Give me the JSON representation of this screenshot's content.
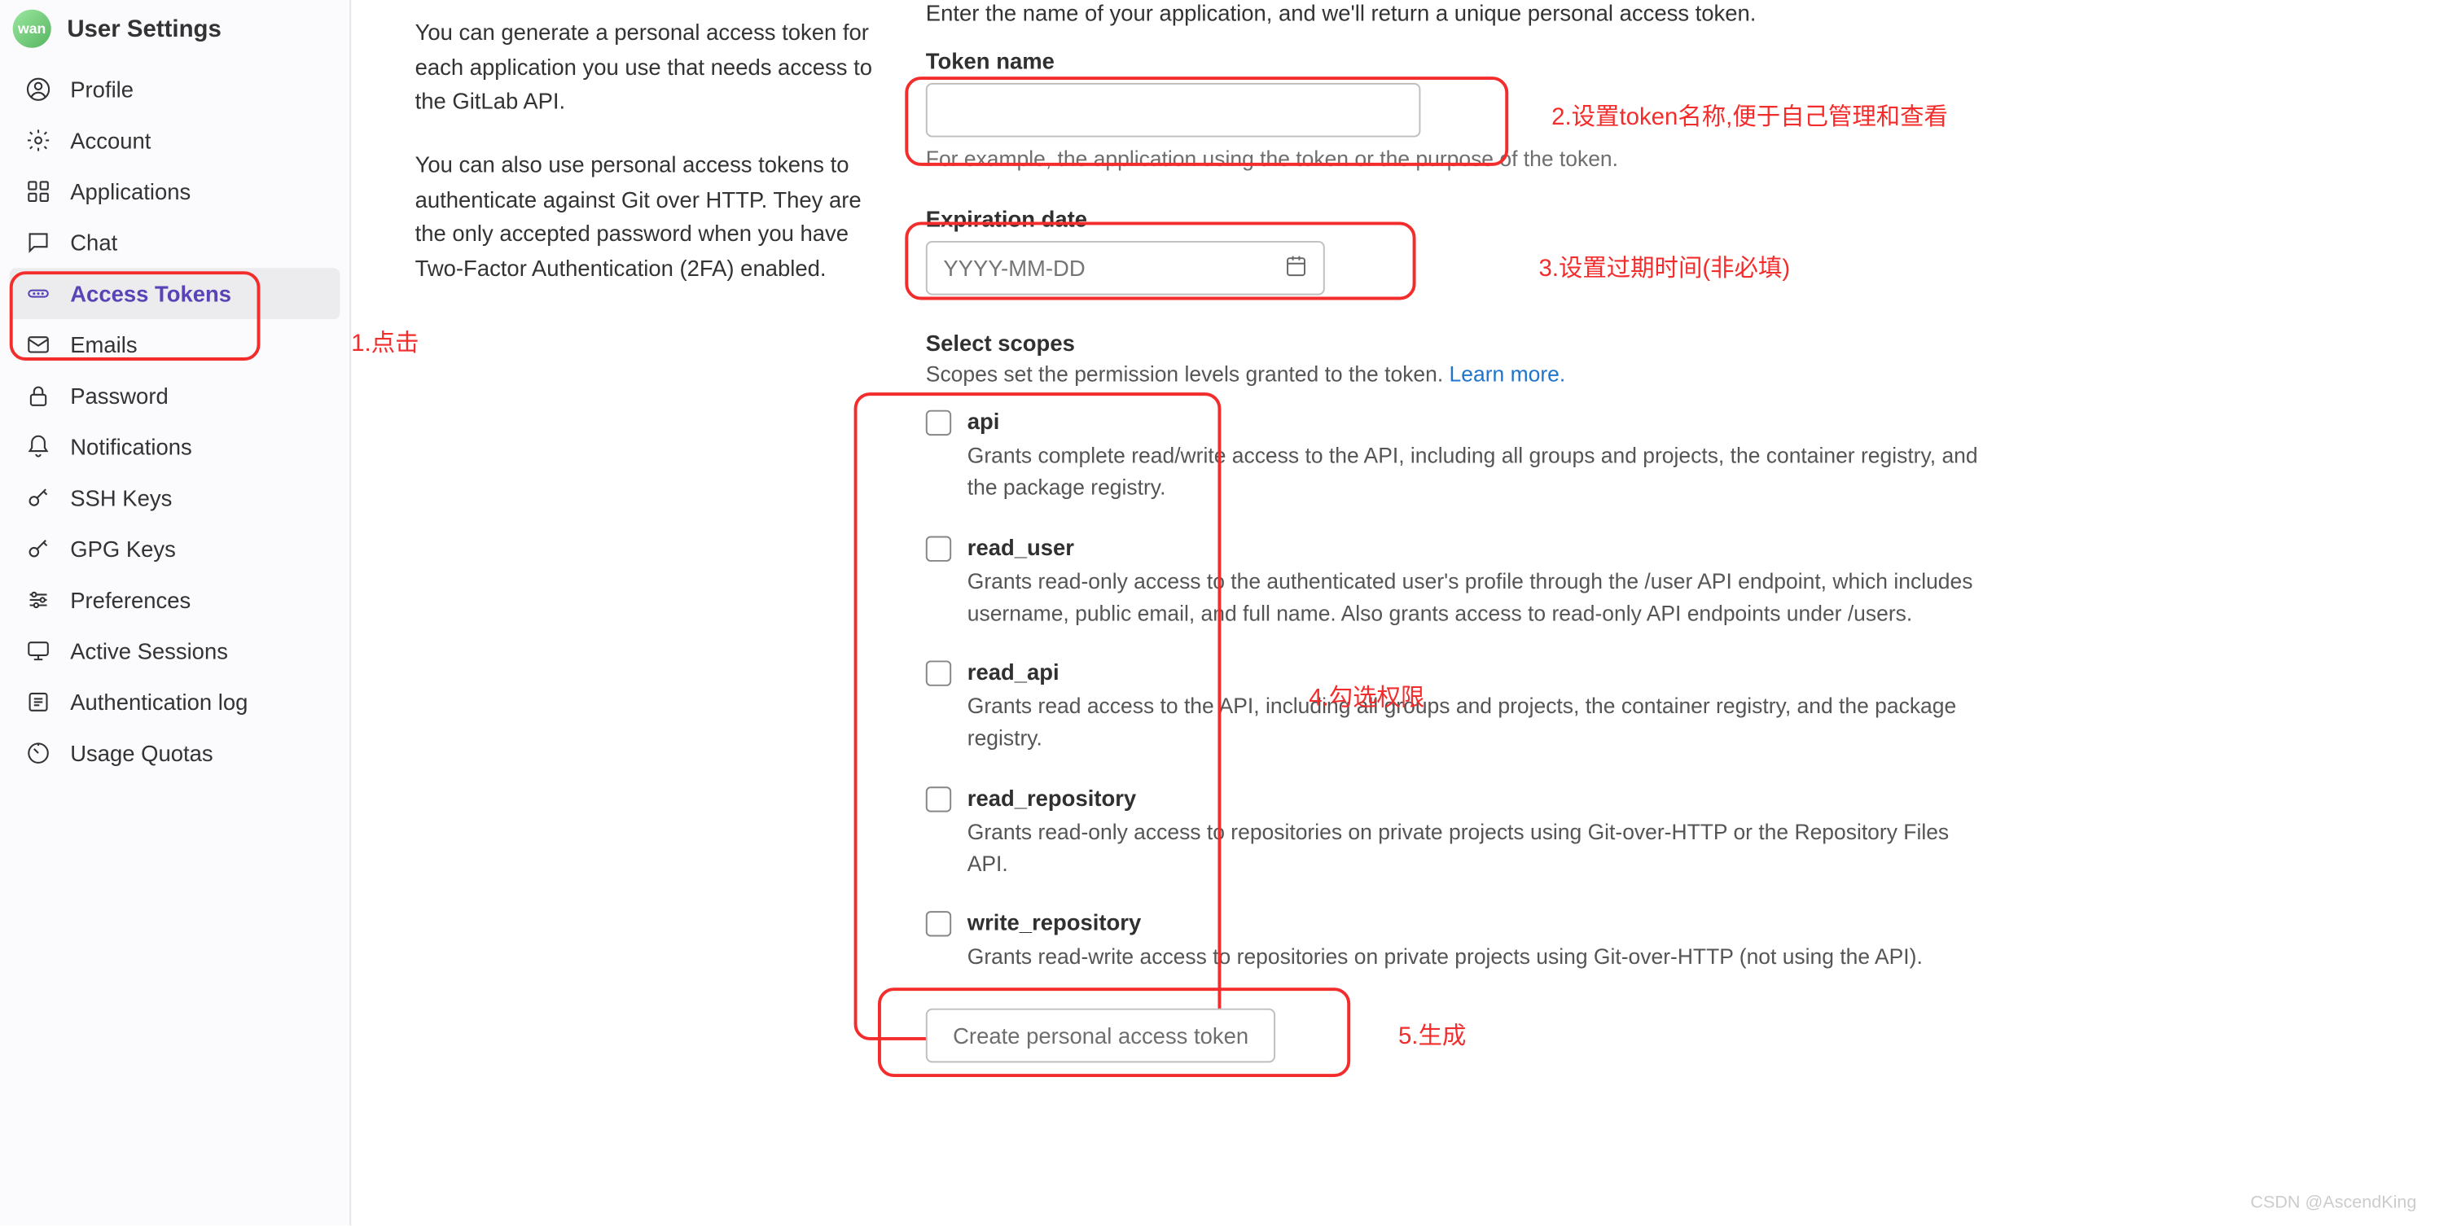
{
  "sidebar": {
    "title": "User Settings",
    "items": [
      {
        "label": "Profile"
      },
      {
        "label": "Account"
      },
      {
        "label": "Applications"
      },
      {
        "label": "Chat"
      },
      {
        "label": "Access Tokens"
      },
      {
        "label": "Emails"
      },
      {
        "label": "Password"
      },
      {
        "label": "Notifications"
      },
      {
        "label": "SSH Keys"
      },
      {
        "label": "GPG Keys"
      },
      {
        "label": "Preferences"
      },
      {
        "label": "Active Sessions"
      },
      {
        "label": "Authentication log"
      },
      {
        "label": "Usage Quotas"
      }
    ]
  },
  "leftCol": {
    "p1": "You can generate a personal access token for each application you use that needs access to the GitLab API.",
    "p2": "You can also use personal access tokens to authenticate against Git over HTTP. They are the only accepted password when you have Two-Factor Authentication (2FA) enabled."
  },
  "form": {
    "intro": "Enter the name of your application, and we'll return a unique personal access token.",
    "tokenName": {
      "label": "Token name",
      "hint": "For example, the application using the token or the purpose of the token."
    },
    "expiration": {
      "label": "Expiration date",
      "placeholder": "YYYY-MM-DD"
    },
    "scopes": {
      "title": "Select scopes",
      "sub": "Scopes set the permission levels granted to the token. ",
      "learn": "Learn more.",
      "items": [
        {
          "name": "api",
          "desc": "Grants complete read/write access to the API, including all groups and projects, the container registry, and the package registry."
        },
        {
          "name": "read_user",
          "desc": "Grants read-only access to the authenticated user's profile through the /user API endpoint, which includes username, public email, and full name. Also grants access to read-only API endpoints under /users."
        },
        {
          "name": "read_api",
          "desc": "Grants read access to the API, including all groups and projects, the container registry, and the package registry."
        },
        {
          "name": "read_repository",
          "desc": "Grants read-only access to repositories on private projects using Git-over-HTTP or the Repository Files API."
        },
        {
          "name": "write_repository",
          "desc": "Grants read-write access to repositories on private projects using Git-over-HTTP (not using the API)."
        }
      ]
    },
    "createBtn": "Create personal access token"
  },
  "annotations": {
    "a1": "1.点击",
    "a2": "2.设置token名称,便于自己管理和查看",
    "a3": "3.设置过期时间(非必填)",
    "a4": "4.勾选权限",
    "a5": "5.生成"
  },
  "watermark": "CSDN @AscendKing"
}
